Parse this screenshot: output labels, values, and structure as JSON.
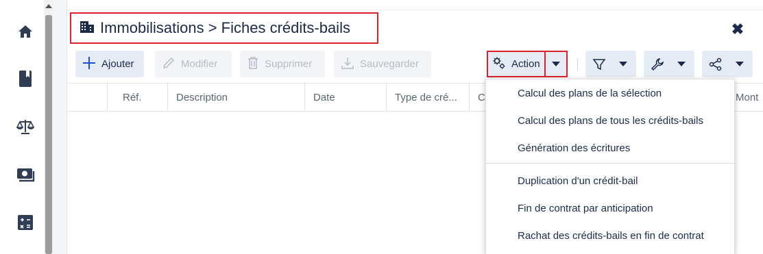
{
  "breadcrumb": "Immobilisations > Fiches crédits-bails",
  "close_symbol": "✖",
  "toolbar": {
    "add_label": "Ajouter",
    "edit_label": "Modifier",
    "delete_label": "Supprimer",
    "save_label": "Sauvegarder",
    "action_label": "Action"
  },
  "columns": [
    "",
    "Réf.",
    "Description",
    "Date",
    "Type de cré...",
    "C",
    "Mont"
  ],
  "action_menu": {
    "group1": [
      "Calcul des plans de la sélection",
      "Calcul des plans de tous les crédits-bails",
      "Génération des écritures"
    ],
    "group2": [
      "Duplication d'un crédit-bail",
      "Fin de contrat par anticipation",
      "Rachat des crédits-bails en fin de contrat"
    ]
  },
  "sidebar_icons": [
    "home-icon",
    "book-icon",
    "scales-icon",
    "money-icon",
    "calculator-icon"
  ],
  "colors": {
    "accent": "#1b2a4a",
    "highlight": "#d9222a",
    "button_bg": "#e6ecf5",
    "primary_icon": "#1e4fd8"
  }
}
